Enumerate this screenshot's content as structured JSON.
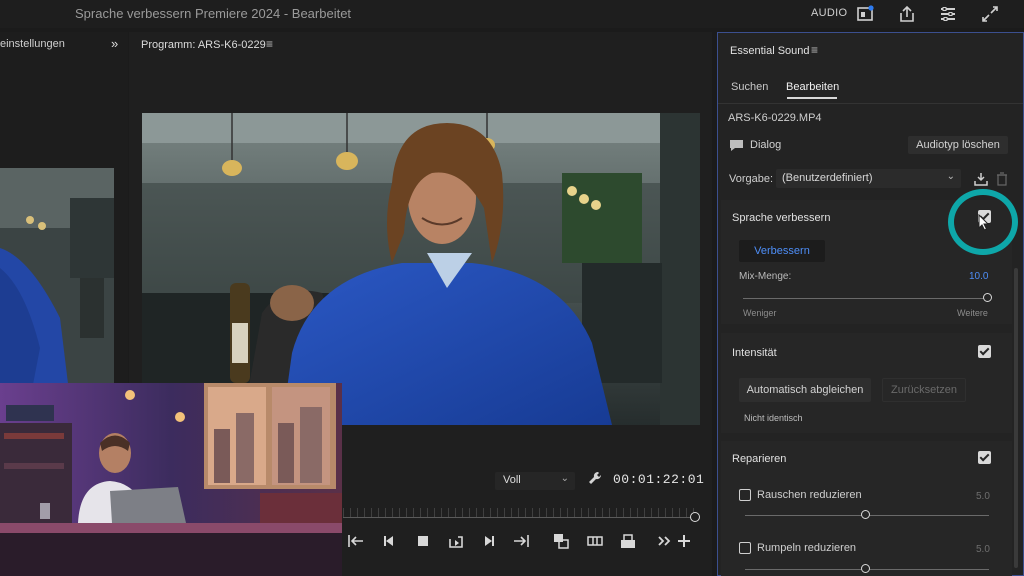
{
  "window": {
    "title": "Sprache verbessern Premiere 2024  -  Bearbeitet",
    "workspace_label": "AUDIO"
  },
  "left_panel": {
    "title": "einstellungen",
    "more_glyph": "»"
  },
  "program_monitor": {
    "title": "Programm: ARS-K6-0229",
    "menu_glyph": "≡",
    "zoom": "Voll",
    "timecode": "00:01:22:01"
  },
  "essential_sound": {
    "title": "Essential Sound",
    "menu_glyph": "≡",
    "tabs": [
      {
        "label": "Suchen",
        "active": false
      },
      {
        "label": "Bearbeiten",
        "active": true
      }
    ],
    "clip_name": "ARS-K6-0229.MP4",
    "audio_type": "Dialog",
    "clear_type_label": "Audiotyp löschen",
    "preset_label": "Vorgabe:",
    "preset_value": "(Benutzerdefiniert)",
    "speech_enhance": {
      "title": "Sprache verbessern",
      "enabled": true,
      "improve_button": "Verbessern",
      "mix_label": "Mix-Menge:",
      "mix_value": "10.0",
      "min_label": "Weniger",
      "max_label": "Weitere"
    },
    "intensity": {
      "title": "Intensität",
      "enabled": true,
      "auto_match_button": "Automatisch abgleichen",
      "reset_button": "Zurücksetzen",
      "status": "Nicht identisch"
    },
    "repair": {
      "title": "Reparieren",
      "enabled": true,
      "items": [
        {
          "label": "Rauschen reduzieren",
          "checked": false,
          "value": "5.0"
        },
        {
          "label": "Rumpeln reduzieren",
          "checked": false,
          "value": "5.0"
        }
      ]
    }
  },
  "colors": {
    "accent_blue": "#4e8ef7",
    "highlight_teal": "#0ea7a9",
    "panel_focus_border": "#3b4f8f"
  },
  "icons": [
    "export-frame-icon",
    "share-icon",
    "panel-menu-icon",
    "expand-icon",
    "wrench-icon",
    "speech-bubble-icon",
    "save-preset-icon",
    "trash-icon",
    "mouse-cursor-icon"
  ]
}
